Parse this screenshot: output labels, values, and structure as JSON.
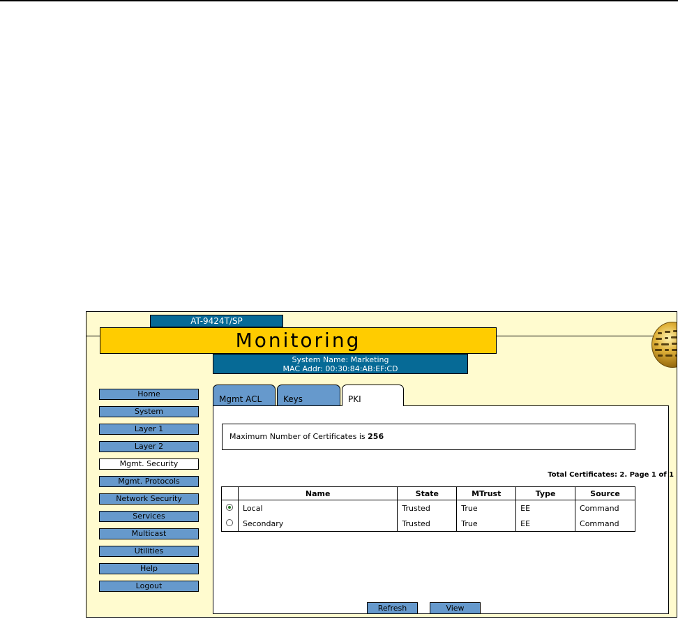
{
  "header": {
    "model": "AT-9424T/SP",
    "title": "Monitoring",
    "system_name": "System Name: Marketing",
    "mac_addr": "MAC Addr: 00:30:84:AB:EF:CD"
  },
  "nav": {
    "items": [
      {
        "label": "Home"
      },
      {
        "label": "System"
      },
      {
        "label": "Layer 1"
      },
      {
        "label": "Layer 2"
      },
      {
        "label": "Mgmt. Security"
      },
      {
        "label": "Mgmt. Protocols"
      },
      {
        "label": "Network Security"
      },
      {
        "label": "Services"
      },
      {
        "label": "Multicast"
      },
      {
        "label": "Utilities"
      },
      {
        "label": "Help"
      },
      {
        "label": "Logout"
      }
    ],
    "active": "Mgmt. Security"
  },
  "tabs": [
    {
      "label": "Mgmt ACL"
    },
    {
      "label": "Keys"
    },
    {
      "label": "PKI"
    }
  ],
  "active_tab": "PKI",
  "pki": {
    "max_text": "Maximum Number of Certificates is",
    "max_value": "256",
    "totals": "Total Certificates: 2. Page 1 of 1",
    "columns": [
      "",
      "Name",
      "State",
      "MTrust",
      "Type",
      "Source"
    ],
    "rows": [
      {
        "selected": true,
        "name": "Local",
        "state": "Trusted",
        "mtrust": "True",
        "type": "EE",
        "source": "Command"
      },
      {
        "selected": false,
        "name": "Secondary",
        "state": "Trusted",
        "mtrust": "True",
        "type": "EE",
        "source": "Command"
      }
    ],
    "refresh_label": "Refresh",
    "view_label": "View"
  },
  "colors": {
    "header_blue": "#066a96",
    "title_yellow": "#ffcc00",
    "frame_bg": "#fffbcf",
    "button_blue": "#6699cc"
  }
}
